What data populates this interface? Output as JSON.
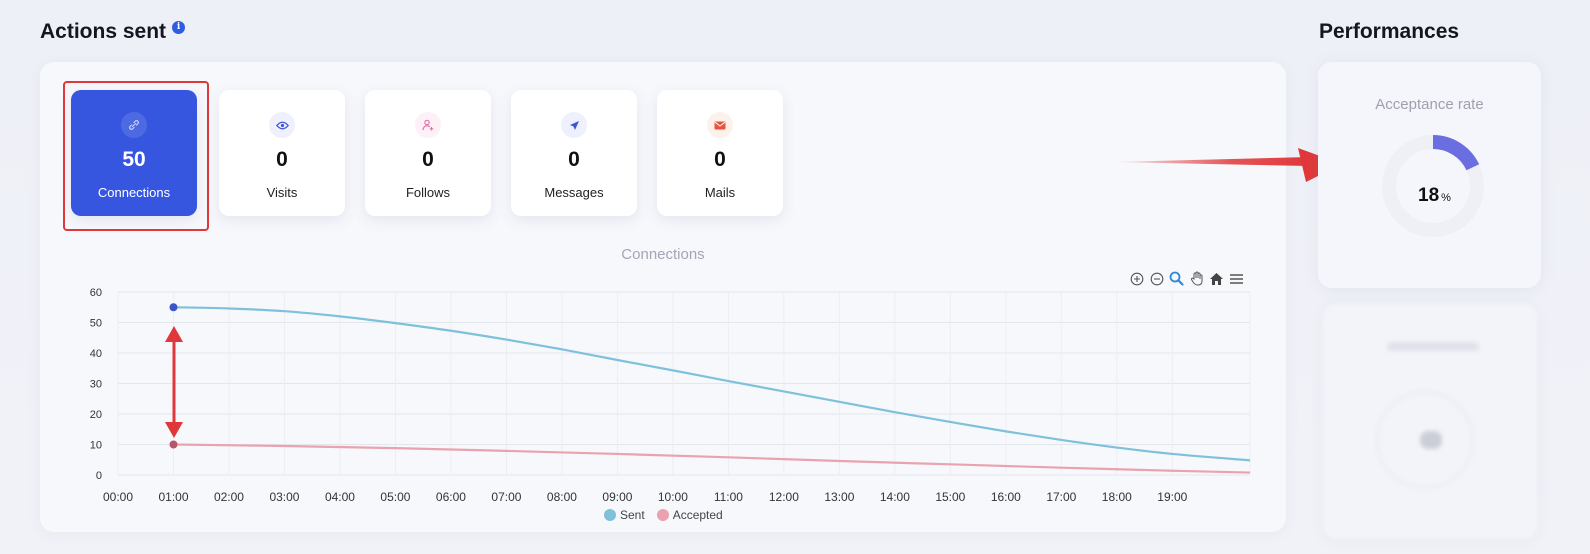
{
  "header": {
    "title": "Actions sent",
    "info_icon": "info-icon",
    "performances_title": "Performances"
  },
  "stats": [
    {
      "icon": "link-icon",
      "value": "50",
      "label": "Connections",
      "active": true
    },
    {
      "icon": "eye-icon",
      "value": "0",
      "label": "Visits",
      "active": false
    },
    {
      "icon": "user-plus-icon",
      "value": "0",
      "label": "Follows",
      "active": false
    },
    {
      "icon": "send-icon",
      "value": "0",
      "label": "Messages",
      "active": false
    },
    {
      "icon": "mail-icon",
      "value": "0",
      "label": "Mails",
      "active": false
    }
  ],
  "toolbar": [
    "zoom-in-icon",
    "zoom-out-icon",
    "zoom-select-icon",
    "pan-icon",
    "home-icon",
    "menu-icon"
  ],
  "chart_data": {
    "type": "line",
    "title": "Connections",
    "x": [
      "00:00",
      "01:00",
      "02:00",
      "03:00",
      "04:00",
      "05:00",
      "06:00",
      "07:00",
      "08:00",
      "09:00",
      "10:00",
      "11:00",
      "12:00",
      "13:00",
      "14:00",
      "15:00",
      "16:00",
      "17:00",
      "18:00",
      "19:00"
    ],
    "ylim": [
      0,
      60
    ],
    "yticks": [
      0,
      10,
      20,
      30,
      40,
      50,
      60
    ],
    "grid": true,
    "legend": "bottom",
    "series": [
      {
        "name": "Sent",
        "color": "#7fc0da",
        "x_start": 1,
        "x_end": 20.4,
        "points": [
          [
            1,
            55
          ],
          [
            2,
            54.6
          ],
          [
            3,
            53.7
          ],
          [
            4,
            52
          ],
          [
            5,
            49.8
          ],
          [
            6,
            47.3
          ],
          [
            7,
            44.4
          ],
          [
            8,
            41.2
          ],
          [
            9,
            37.7
          ],
          [
            10,
            34.3
          ],
          [
            11,
            30.8
          ],
          [
            12,
            27.4
          ],
          [
            13,
            24
          ],
          [
            14,
            20.6
          ],
          [
            15,
            17.4
          ],
          [
            16,
            14.3
          ],
          [
            17,
            11.5
          ],
          [
            18,
            9
          ],
          [
            19,
            6.9
          ],
          [
            20.4,
            4.8
          ]
        ]
      },
      {
        "name": "Accepted",
        "color": "#e9a2ae",
        "x_start": 1,
        "x_end": 20.4,
        "points": [
          [
            1,
            10
          ],
          [
            3,
            9.5
          ],
          [
            5,
            8.8
          ],
          [
            7,
            7.9
          ],
          [
            9,
            6.9
          ],
          [
            11,
            5.8
          ],
          [
            13,
            4.6
          ],
          [
            15,
            3.5
          ],
          [
            17,
            2.4
          ],
          [
            19,
            1.4
          ],
          [
            20.4,
            0.8
          ]
        ]
      }
    ],
    "marker_colors": {
      "sent_start": "#3a55c9",
      "accepted_start": "#b5566a"
    }
  },
  "annotations": {
    "arrow_color": "#e0383a"
  },
  "performance": {
    "acceptance_title": "Acceptance rate",
    "acceptance_value": "18",
    "acceptance_unit": "%",
    "acceptance_fraction": 0.18,
    "donut_color": "#6b6ee0"
  }
}
